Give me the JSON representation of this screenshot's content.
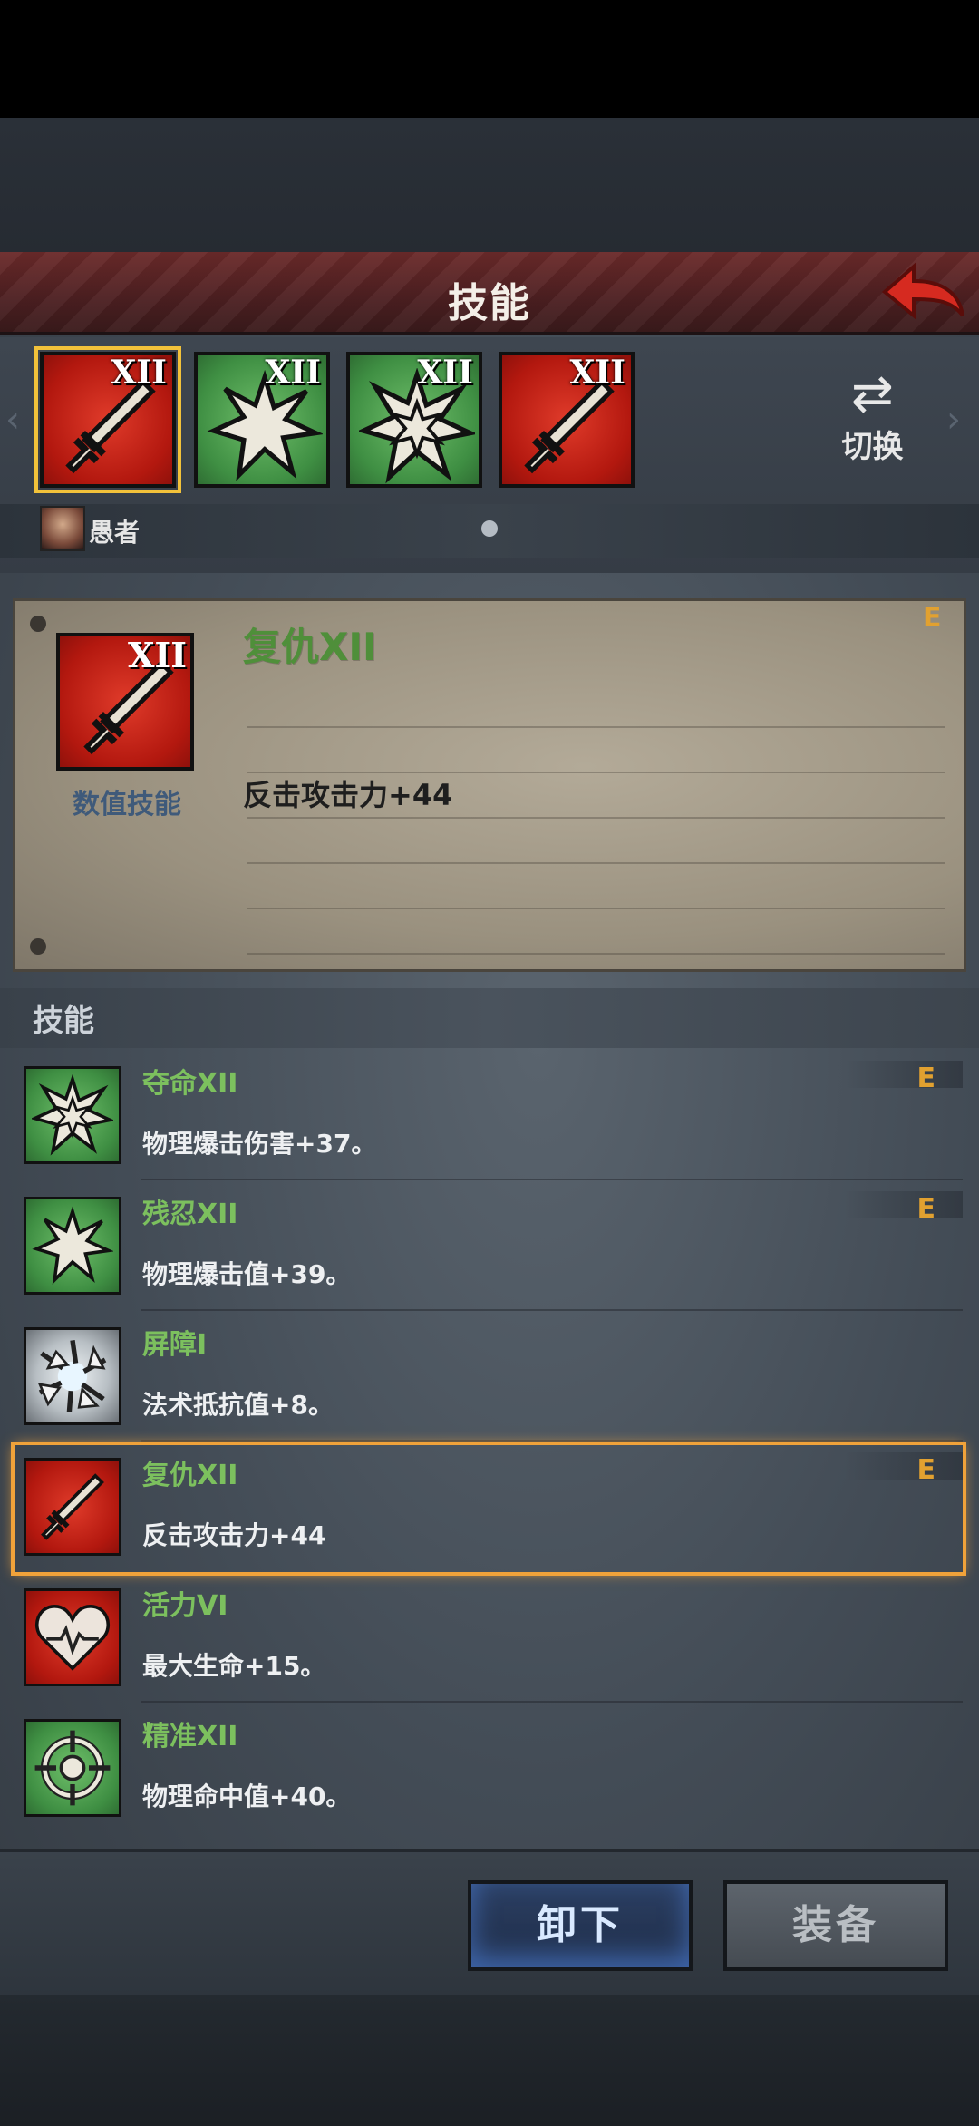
{
  "header": {
    "title": "技能"
  },
  "slots": [
    {
      "roman": "XII",
      "color": "red",
      "icon": "sword-icon"
    },
    {
      "roman": "XII",
      "color": "green",
      "icon": "burst-icon"
    },
    {
      "roman": "XII",
      "color": "green",
      "icon": "double-burst-icon"
    },
    {
      "roman": "XII",
      "color": "red",
      "icon": "sword-icon"
    }
  ],
  "switch_label": "切换",
  "character": {
    "name": "愚者"
  },
  "detail": {
    "roman": "XII",
    "name": "复仇XII",
    "type": "数值技能",
    "grade": "E",
    "description": "反击攻击力+44"
  },
  "list_title": "技能",
  "skills": [
    {
      "name": "夺命XII",
      "desc": "物理爆击伤害+37。",
      "grade": "E",
      "color": "green",
      "icon": "double-burst-icon"
    },
    {
      "name": "残忍XII",
      "desc": "物理爆击值+39。",
      "grade": "E",
      "color": "green",
      "icon": "burst-icon"
    },
    {
      "name": "屏障I",
      "desc": "法术抵抗值+8。",
      "grade": "",
      "color": "gray",
      "icon": "shatter-icon"
    },
    {
      "name": "复仇XII",
      "desc": "反击攻击力+44",
      "grade": "E",
      "color": "red",
      "icon": "sword-icon"
    },
    {
      "name": "活力VI",
      "desc": "最大生命+15。",
      "grade": "",
      "color": "red",
      "icon": "heart-icon"
    },
    {
      "name": "精准XII",
      "desc": "物理命中值+40。",
      "grade": "",
      "color": "green",
      "icon": "crosshair-icon"
    }
  ],
  "buttons": {
    "unequip": "卸下",
    "equip": "装备"
  },
  "colors": {
    "accent_gold": "#f2c23a",
    "grade_orange": "#e2a130",
    "skill_green": "#7cc05e"
  }
}
